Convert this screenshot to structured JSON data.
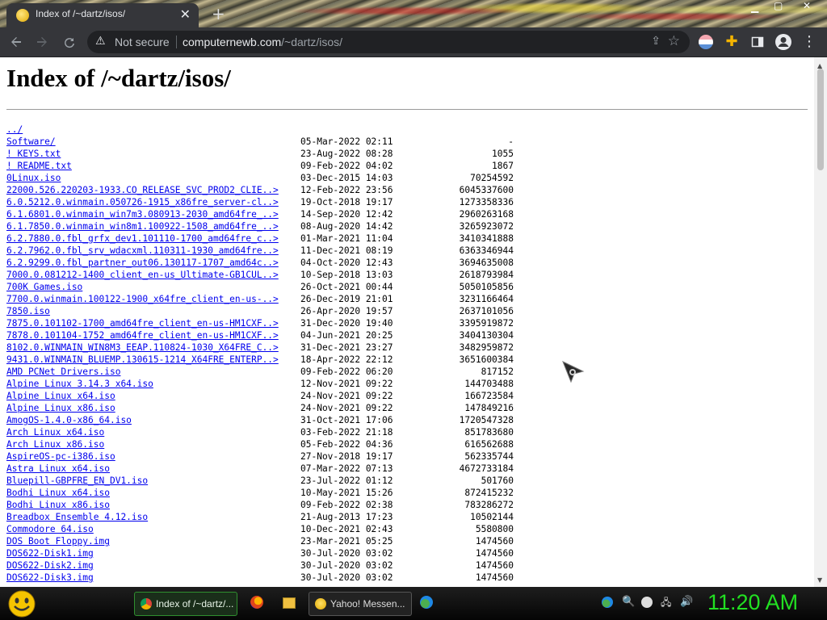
{
  "browser": {
    "tab_title": "Index of /~dartz/isos/",
    "tab_close": "✕",
    "new_tab": "+",
    "security_label": "Not secure",
    "url_host": "computernewb.com",
    "url_path": "/~dartz/isos/"
  },
  "page": {
    "heading": "Index of /~dartz/isos/",
    "entries": [
      {
        "name": "../",
        "date": "",
        "size": ""
      },
      {
        "name": "Software/",
        "date": "05-Mar-2022 02:11",
        "size": "-"
      },
      {
        "name": "! KEYS.txt",
        "date": "23-Aug-2022 08:28",
        "size": "1055"
      },
      {
        "name": "! README.txt",
        "date": "09-Feb-2022 04:02",
        "size": "1867"
      },
      {
        "name": "0Linux.iso",
        "date": "03-Dec-2015 14:03",
        "size": "70254592"
      },
      {
        "name": "22000.526.220203-1933.CO_RELEASE_SVC_PROD2_CLIE..>",
        "date": "12-Feb-2022 23:56",
        "size": "6045337600"
      },
      {
        "name": "6.0.5212.0.winmain.050726-1915_x86fre_server-cl..>",
        "date": "19-Oct-2018 19:17",
        "size": "1273358336"
      },
      {
        "name": "6.1.6801.0.winmain_win7m3.080913-2030_amd64fre_..>",
        "date": "14-Sep-2020 12:42",
        "size": "2960263168"
      },
      {
        "name": "6.1.7850.0.winmain_win8m1.100922-1508_amd64fre_..>",
        "date": "08-Aug-2020 14:42",
        "size": "3265923072"
      },
      {
        "name": "6.2.7880.0.fbl_grfx_dev1.101110-1700_amd64fre_c..>",
        "date": "01-Mar-2021 11:04",
        "size": "3410341888"
      },
      {
        "name": "6.2.7962.0.fbl_srv_wdacxml.110311-1930_amd64fre..>",
        "date": "11-Dec-2021 08:19",
        "size": "6363346944"
      },
      {
        "name": "6.2.9299.0.fbl_partner_out06.130117-1707_amd64c..>",
        "date": "04-Oct-2020 12:43",
        "size": "3694635008"
      },
      {
        "name": "7000.0.081212-1400_client_en-us_Ultimate-GB1CUL..>",
        "date": "10-Sep-2018 13:03",
        "size": "2618793984"
      },
      {
        "name": "700K Games.iso",
        "date": "26-Oct-2021 00:44",
        "size": "5050105856"
      },
      {
        "name": "7700.0.winmain.100122-1900_x64fre_client_en-us-..>",
        "date": "26-Dec-2019 21:01",
        "size": "3231166464"
      },
      {
        "name": "7850.iso",
        "date": "26-Apr-2020 19:57",
        "size": "2637101056"
      },
      {
        "name": "7875.0.101102-1700_amd64fre_client_en-us-HM1CXF..>",
        "date": "31-Dec-2020 19:40",
        "size": "3395919872"
      },
      {
        "name": "7878.0.101104-1752_amd64fre_client_en-us-HM1CXF..>",
        "date": "04-Jun-2021 20:25",
        "size": "3404130304"
      },
      {
        "name": "8102.0.WINMAIN_WIN8M3_EEAP.110824-1030_X64FRE_C..>",
        "date": "31-Dec-2021 23:27",
        "size": "3482959872"
      },
      {
        "name": "9431.0.WINMAIN_BLUEMP.130615-1214_X64FRE_ENTERP..>",
        "date": "18-Apr-2022 22:12",
        "size": "3651600384"
      },
      {
        "name": "AMD PCNet Drivers.iso",
        "date": "09-Feb-2022 06:20",
        "size": "817152"
      },
      {
        "name": "Alpine Linux 3.14.3 x64.iso",
        "date": "12-Nov-2021 09:22",
        "size": "144703488"
      },
      {
        "name": "Alpine Linux x64.iso",
        "date": "24-Nov-2021 09:22",
        "size": "166723584"
      },
      {
        "name": "Alpine Linux x86.iso",
        "date": "24-Nov-2021 09:22",
        "size": "147849216"
      },
      {
        "name": "AmogOS-1.4.0-x86_64.iso",
        "date": "31-Oct-2021 17:06",
        "size": "1720547328"
      },
      {
        "name": "Arch Linux x64.iso",
        "date": "03-Feb-2022 21:18",
        "size": "851783680"
      },
      {
        "name": "Arch Linux x86.iso",
        "date": "05-Feb-2022 04:36",
        "size": "616562688"
      },
      {
        "name": "AspireOS-pc-i386.iso",
        "date": "27-Nov-2018 19:17",
        "size": "562335744"
      },
      {
        "name": "Astra Linux x64.iso",
        "date": "07-Mar-2022 07:13",
        "size": "4672733184"
      },
      {
        "name": "Bluepill-GBPFRE_EN_DV1.iso",
        "date": "23-Jul-2022 01:12",
        "size": "501760"
      },
      {
        "name": "Bodhi Linux x64.iso",
        "date": "10-May-2021 15:26",
        "size": "872415232"
      },
      {
        "name": "Bodhi Linux x86.iso",
        "date": "09-Feb-2022 02:38",
        "size": "783286272"
      },
      {
        "name": "Breadbox Ensemble 4.12.iso",
        "date": "21-Aug-2013 17:23",
        "size": "10502144"
      },
      {
        "name": "Commodore 64.iso",
        "date": "10-Dec-2021 02:43",
        "size": "5580800"
      },
      {
        "name": "DOS Boot Floppy.img",
        "date": "23-Mar-2021 05:25",
        "size": "1474560"
      },
      {
        "name": "DOS622-Disk1.img",
        "date": "30-Jul-2020 03:02",
        "size": "1474560"
      },
      {
        "name": "DOS622-Disk2.img",
        "date": "30-Jul-2020 03:02",
        "size": "1474560"
      },
      {
        "name": "DOS622-Disk3.img",
        "date": "30-Jul-2020 03:02",
        "size": "1474560"
      }
    ]
  },
  "taskbar": {
    "tasks": [
      {
        "label": "Index of /~dartz/...",
        "icon": "chrome-icon"
      },
      {
        "label": "Yahoo! Messen...",
        "icon": "yahoo-messenger-icon"
      }
    ],
    "clock": "11:20 AM"
  },
  "colors": {
    "link": "#0000ee",
    "chrome_dark": "#35363a",
    "omnibox": "#202124",
    "clock_green": "#22e022"
  }
}
